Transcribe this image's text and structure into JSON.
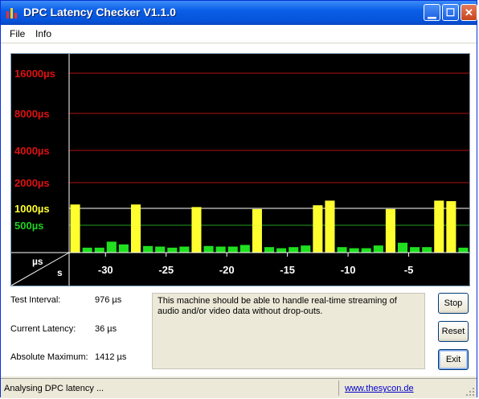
{
  "window": {
    "title": "DPC Latency Checker V1.1.0",
    "minimize_glyph": "▁",
    "maximize_glyph": "☐",
    "close_glyph": "✕",
    "app_icon": "bar-chart-icon"
  },
  "menu": {
    "file_label": "File",
    "info_label": "Info"
  },
  "chart_data": {
    "type": "bar",
    "title": "",
    "y_unit_label": "µs",
    "x_unit_label": "s",
    "y_scale": "log-like",
    "y_ticks": [
      {
        "label": "16000µs",
        "value": 16000,
        "color": "#e01010"
      },
      {
        "label": "8000µs",
        "value": 8000,
        "color": "#e01010"
      },
      {
        "label": "4000µs",
        "value": 4000,
        "color": "#e01010"
      },
      {
        "label": "2000µs",
        "value": 2000,
        "color": "#e01010"
      },
      {
        "label": "1000µs",
        "value": 1000,
        "color": "#ffff30"
      },
      {
        "label": "500µs",
        "value": 500,
        "color": "#20d020"
      }
    ],
    "x_ticks": [
      {
        "label": "-30",
        "value": -30
      },
      {
        "label": "-25",
        "value": -25
      },
      {
        "label": "-20",
        "value": -20
      },
      {
        "label": "-15",
        "value": -15
      },
      {
        "label": "-10",
        "value": -10
      },
      {
        "label": "-5",
        "value": -5
      }
    ],
    "xlim": [
      -33,
      0
    ],
    "bars": [
      {
        "t": -32.5,
        "value": 1150,
        "color": "yellow"
      },
      {
        "t": -31.5,
        "value": 90,
        "color": "green"
      },
      {
        "t": -30.5,
        "value": 90,
        "color": "green"
      },
      {
        "t": -29.5,
        "value": 200,
        "color": "green"
      },
      {
        "t": -28.5,
        "value": 150,
        "color": "green"
      },
      {
        "t": -27.5,
        "value": 1150,
        "color": "yellow"
      },
      {
        "t": -26.5,
        "value": 120,
        "color": "green"
      },
      {
        "t": -25.5,
        "value": 110,
        "color": "green"
      },
      {
        "t": -24.5,
        "value": 90,
        "color": "green"
      },
      {
        "t": -23.5,
        "value": 110,
        "color": "green"
      },
      {
        "t": -22.5,
        "value": 1050,
        "color": "yellow"
      },
      {
        "t": -21.5,
        "value": 120,
        "color": "green"
      },
      {
        "t": -20.5,
        "value": 110,
        "color": "green"
      },
      {
        "t": -19.5,
        "value": 110,
        "color": "green"
      },
      {
        "t": -18.5,
        "value": 140,
        "color": "green"
      },
      {
        "t": -17.5,
        "value": 980,
        "color": "yellow"
      },
      {
        "t": -16.5,
        "value": 100,
        "color": "green"
      },
      {
        "t": -15.5,
        "value": 80,
        "color": "green"
      },
      {
        "t": -14.5,
        "value": 100,
        "color": "green"
      },
      {
        "t": -13.5,
        "value": 130,
        "color": "green"
      },
      {
        "t": -12.5,
        "value": 1120,
        "color": "yellow"
      },
      {
        "t": -11.5,
        "value": 1300,
        "color": "yellow"
      },
      {
        "t": -10.5,
        "value": 100,
        "color": "green"
      },
      {
        "t": -9.5,
        "value": 80,
        "color": "green"
      },
      {
        "t": -8.5,
        "value": 80,
        "color": "green"
      },
      {
        "t": -7.5,
        "value": 130,
        "color": "green"
      },
      {
        "t": -6.5,
        "value": 980,
        "color": "yellow"
      },
      {
        "t": -5.5,
        "value": 180,
        "color": "green"
      },
      {
        "t": -4.5,
        "value": 100,
        "color": "green"
      },
      {
        "t": -3.5,
        "value": 100,
        "color": "green"
      },
      {
        "t": -2.5,
        "value": 1300,
        "color": "yellow"
      },
      {
        "t": -1.5,
        "value": 1280,
        "color": "yellow"
      },
      {
        "t": -0.5,
        "value": 90,
        "color": "green"
      }
    ],
    "colors": {
      "background": "#000000",
      "yellow": "#ffff30",
      "green": "#20e020",
      "red_line": "#b01010",
      "grid_text_red": "#e02020",
      "axis": "#ffffff"
    },
    "grid": true
  },
  "info": {
    "test_interval_label": "Test Interval:",
    "test_interval_value": "976 µs",
    "current_latency_label": "Current Latency:",
    "current_latency_value": "36 µs",
    "absolute_max_label": "Absolute Maximum:",
    "absolute_max_value": "1412 µs",
    "message": "This machine should be able to handle real-time streaming of audio and/or video data without drop-outs."
  },
  "buttons": {
    "stop_label": "Stop",
    "reset_label": "Reset",
    "exit_label": "Exit"
  },
  "status": {
    "text": "Analysing DPC latency ...",
    "link": "www.thesycon.de"
  }
}
